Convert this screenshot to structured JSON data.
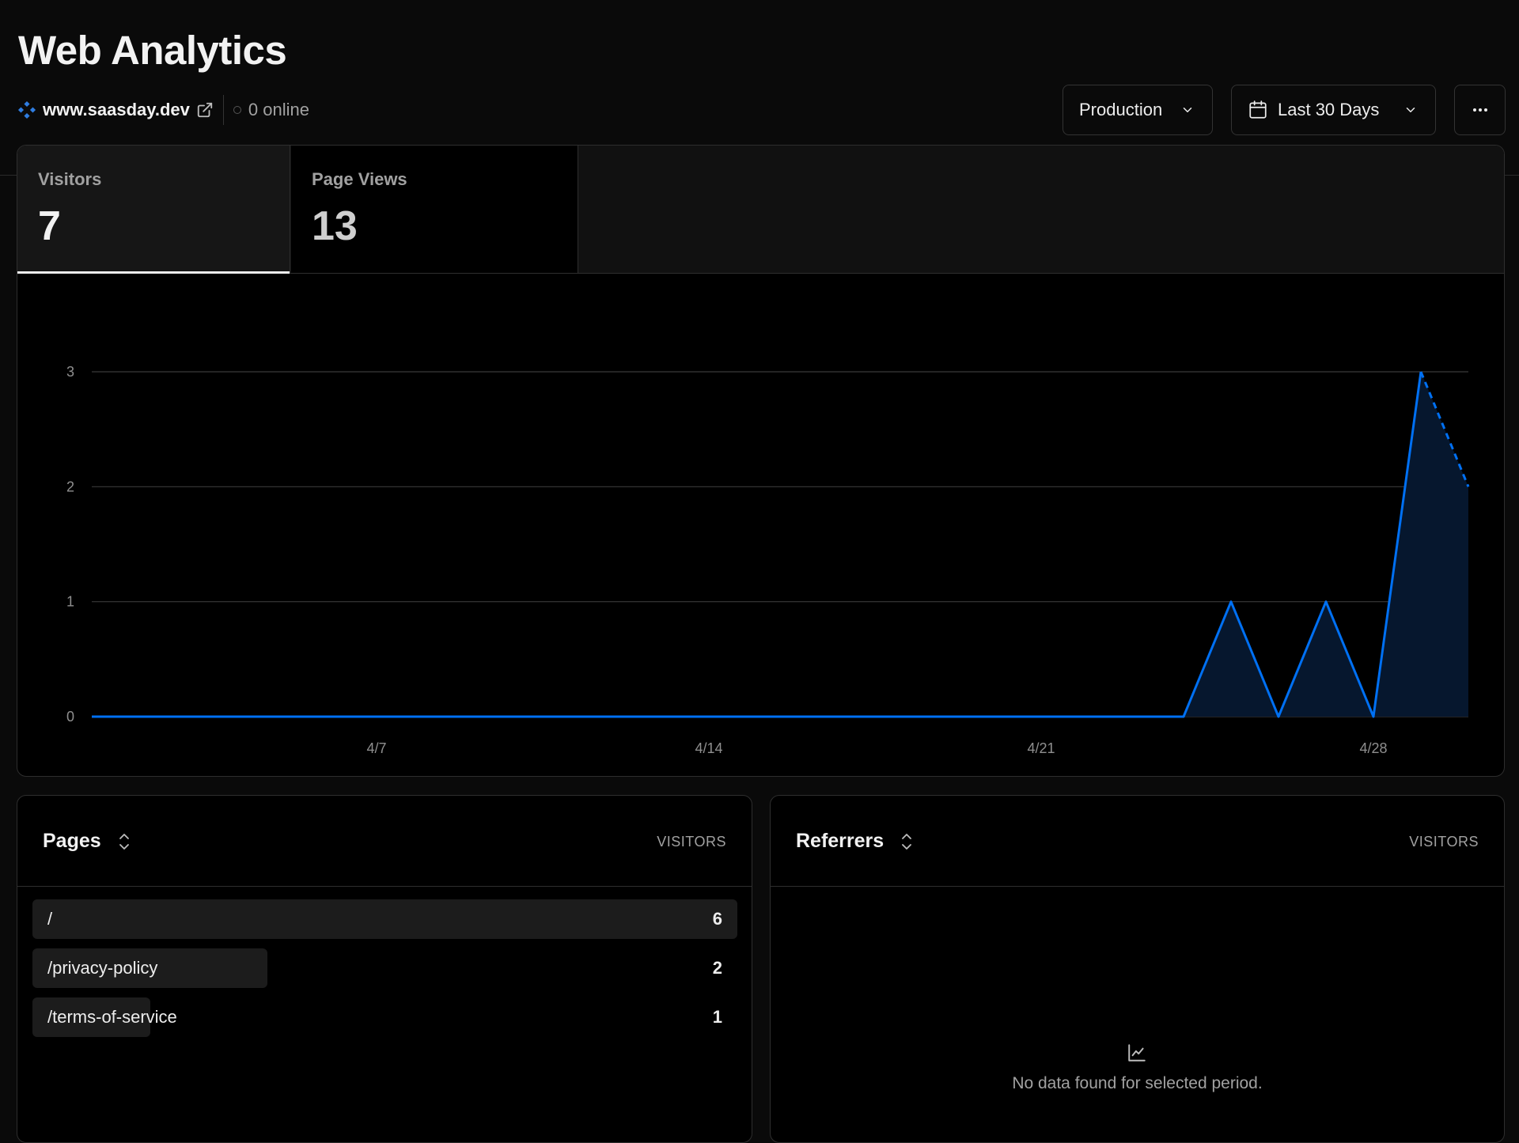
{
  "header": {
    "title": "Web Analytics",
    "domain": "www.saasday.dev",
    "online": "0 online"
  },
  "controls": {
    "environment": "Production",
    "date_range": "Last 30 Days",
    "more": "⋯"
  },
  "stats": {
    "visitors_label": "Visitors",
    "visitors_value": "7",
    "pageviews_label": "Page Views",
    "pageviews_value": "13"
  },
  "colors": {
    "accent": "#0070f3",
    "area_fill": "#06172e"
  },
  "chart_data": {
    "type": "area",
    "x": [
      "4/1",
      "4/2",
      "4/3",
      "4/4",
      "4/5",
      "4/6",
      "4/7",
      "4/8",
      "4/9",
      "4/10",
      "4/11",
      "4/12",
      "4/13",
      "4/14",
      "4/15",
      "4/16",
      "4/17",
      "4/18",
      "4/19",
      "4/20",
      "4/21",
      "4/22",
      "4/23",
      "4/24",
      "4/25",
      "4/26",
      "4/27",
      "4/28",
      "4/29",
      "4/30"
    ],
    "values": [
      0,
      0,
      0,
      0,
      0,
      0,
      0,
      0,
      0,
      0,
      0,
      0,
      0,
      0,
      0,
      0,
      0,
      0,
      0,
      0,
      0,
      0,
      0,
      0,
      1,
      0,
      1,
      0,
      3,
      2
    ],
    "ylim": [
      0,
      3
    ],
    "yticks": [
      "0",
      "1",
      "2",
      "3"
    ],
    "xticks": [
      "4/7",
      "4/14",
      "4/21",
      "4/28"
    ],
    "xtick_indices": [
      6,
      13,
      20,
      27
    ],
    "projected_last_point": true,
    "grid": true
  },
  "pages": {
    "title": "Pages",
    "column": "VISITORS",
    "rows": [
      {
        "label": "/",
        "count": "6"
      },
      {
        "label": "/privacy-policy",
        "count": "2"
      },
      {
        "label": "/terms-of-service",
        "count": "1"
      }
    ]
  },
  "referrers": {
    "title": "Referrers",
    "column": "VISITORS",
    "empty": "No data found for selected period."
  }
}
